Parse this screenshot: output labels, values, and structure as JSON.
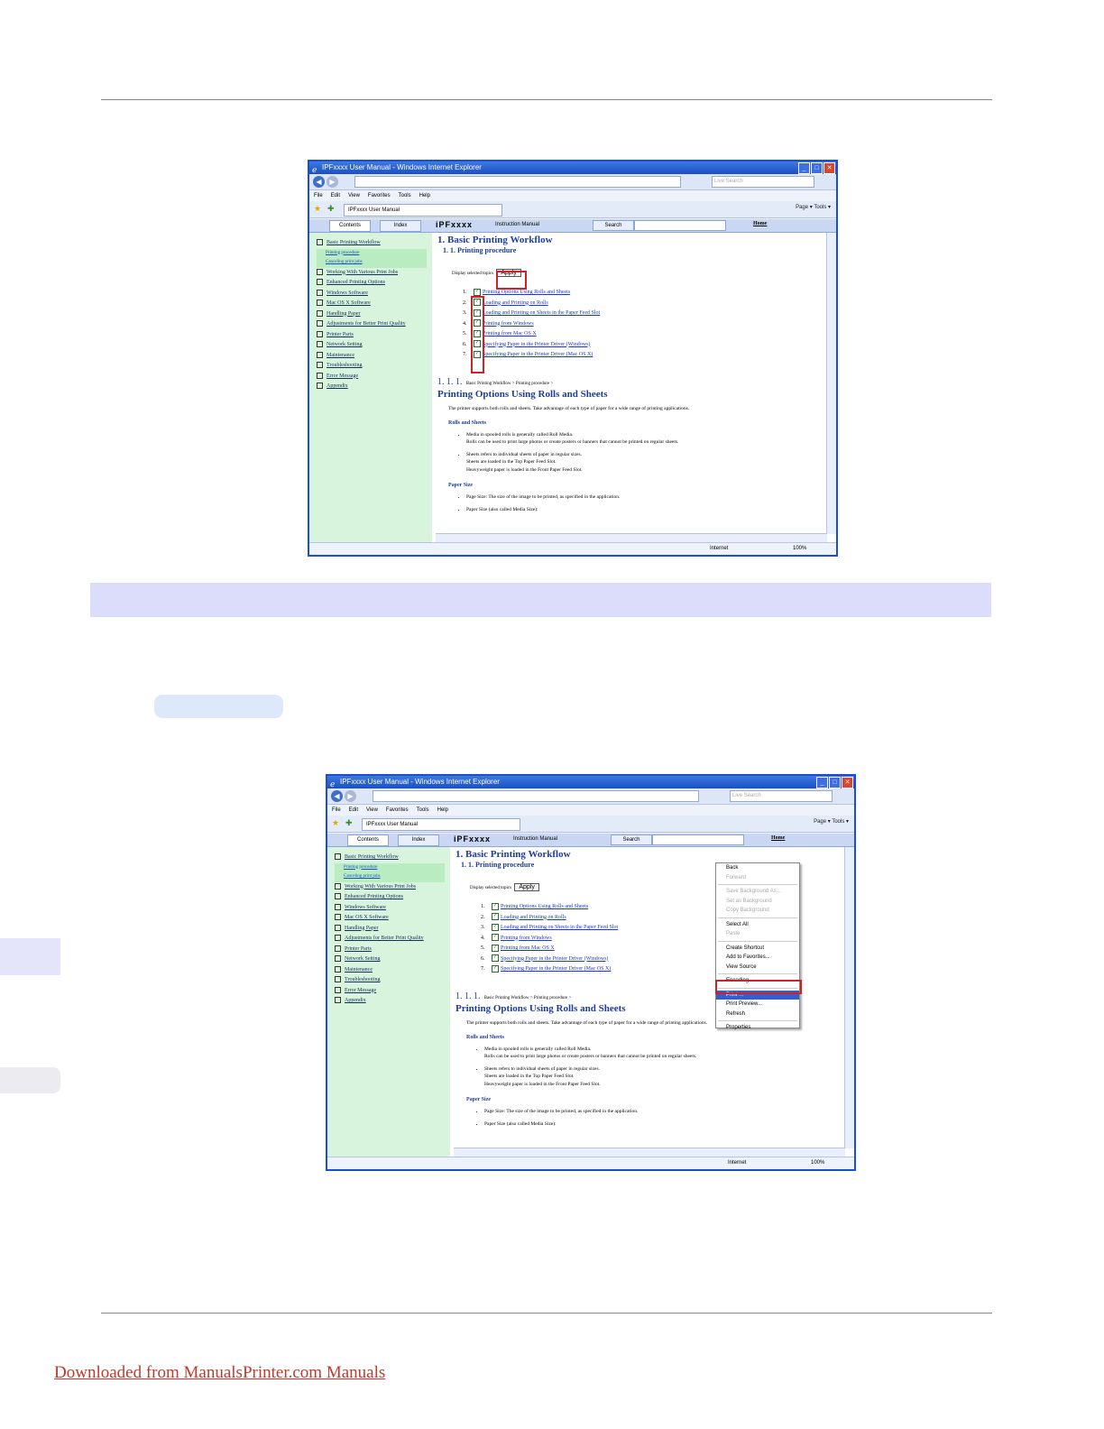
{
  "browser": {
    "title": "IPFxxxx User Manual - Windows Internet Explorer",
    "search_placeholder": "Live Search",
    "menu": [
      "File",
      "Edit",
      "View",
      "Favorites",
      "Tools",
      "Help"
    ],
    "fav_tab": "IPFxxxx User Manual",
    "toolbar_right": "Page ▾  Tools ▾",
    "status_zone": "Internet",
    "status_zoom": "100%"
  },
  "manual": {
    "tab_contents": "Contents",
    "tab_index": "Index",
    "brand": "iPFxxxx",
    "brand_sub": "Instruction Manual",
    "search_button": "Search",
    "home_link": "Home",
    "sidebar": [
      {
        "label": "Basic Printing Workflow",
        "sub": false
      },
      {
        "label": "Printing procedure",
        "sub": true
      },
      {
        "label": "Canceling print jobs",
        "sub": true
      },
      {
        "label": "Working With Various Print Jobs",
        "sub": false
      },
      {
        "label": "Enhanced Printing Options",
        "sub": false
      },
      {
        "label": "Windows Software",
        "sub": false
      },
      {
        "label": "Mac OS X Software",
        "sub": false
      },
      {
        "label": "Handling Paper",
        "sub": false
      },
      {
        "label": "Adjustments for Better Print Quality",
        "sub": false
      },
      {
        "label": "Printer Parts",
        "sub": false
      },
      {
        "label": "Network Setting",
        "sub": false
      },
      {
        "label": "Maintenance",
        "sub": false
      },
      {
        "label": "Troubleshooting",
        "sub": false
      },
      {
        "label": "Error Message",
        "sub": false
      },
      {
        "label": "Appendix",
        "sub": false
      }
    ],
    "h1": "1. Basic Printing Workflow",
    "h2": "1. 1. Printing procedure",
    "display_label": "Display selected topics",
    "apply": "Apply",
    "topics": [
      "Printing Options Using Rolls and Sheets",
      "Loading and Printing on Rolls",
      "Loading and Printing on Sheets in the Paper Feed Slot",
      "Printing from Windows",
      "Printing from Mac OS X",
      "Specifying Paper in the Printer Driver (Windows)",
      "Specifying Paper in the Printer Driver (Mac OS X)"
    ],
    "section_number": "1. 1. 1.",
    "breadcrumb": "Basic Printing Workflow > Printing procedure >",
    "section_title": "Printing Options Using Rolls and Sheets",
    "intro": "The printer supports both rolls and sheets. Take advantage of each type of paper for a wide range of printing applications.",
    "rolls_heading": "Rolls and Sheets",
    "bullet_rolls": [
      "Media in spooled rolls is generally called Roll Media.",
      "Rolls can be used to print large photos or create posters or banners that cannot be printed on regular sheets."
    ],
    "bullet_sheets": [
      "Sheets refers to individual sheets of paper in regular sizes.",
      "Sheets are loaded in the Top Paper Feed Slot.",
      "Heavyweight paper is loaded in the Front Paper Feed Slot."
    ],
    "paper_heading": "Paper Size",
    "bullet_paper": [
      "Page Size: The size of the image to be printed, as specified in the application.",
      "Paper Size (also called Media Size):"
    ]
  },
  "context_menu": {
    "items": [
      {
        "label": "Back",
        "state": "normal"
      },
      {
        "label": "Forward",
        "state": "disabled"
      },
      {
        "label": "",
        "state": "separator"
      },
      {
        "label": "Save Background As...",
        "state": "disabled"
      },
      {
        "label": "Set as Background",
        "state": "disabled"
      },
      {
        "label": "Copy Background",
        "state": "disabled"
      },
      {
        "label": "",
        "state": "separator"
      },
      {
        "label": "Select All",
        "state": "normal"
      },
      {
        "label": "Paste",
        "state": "disabled"
      },
      {
        "label": "",
        "state": "separator"
      },
      {
        "label": "Create Shortcut",
        "state": "normal"
      },
      {
        "label": "Add to Favorites...",
        "state": "normal"
      },
      {
        "label": "View Source",
        "state": "normal"
      },
      {
        "label": "",
        "state": "separator"
      },
      {
        "label": "Encoding",
        "state": "normal"
      },
      {
        "label": "",
        "state": "separator"
      },
      {
        "label": "Print ...",
        "state": "selected"
      },
      {
        "label": "Print Preview...",
        "state": "normal"
      },
      {
        "label": "Refresh",
        "state": "normal"
      },
      {
        "label": "",
        "state": "separator"
      },
      {
        "label": "Properties",
        "state": "normal"
      }
    ]
  },
  "footer": {
    "link": "Downloaded from ManualsPrinter.com Manuals"
  },
  "colors": {
    "band": "#dcdcfb",
    "pill": "#dde9fb",
    "sidebar": "#d8f4dc",
    "highlight_red": "#d0202a"
  }
}
